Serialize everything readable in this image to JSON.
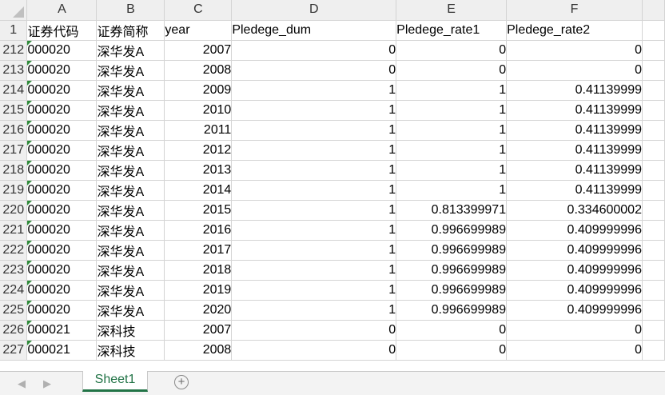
{
  "columns": [
    "A",
    "B",
    "C",
    "D",
    "E",
    "F"
  ],
  "header_row": {
    "row_num": "1",
    "cells": [
      "证券代码",
      "证券简称",
      "year",
      "Pledege_dum",
      "Pledege_rate1",
      "Pledege_rate2"
    ]
  },
  "rows": [
    {
      "num": "212",
      "code": "000020",
      "name": "深华发A",
      "year": "2007",
      "dum": "0",
      "rate1": "0",
      "rate2": "0"
    },
    {
      "num": "213",
      "code": "000020",
      "name": "深华发A",
      "year": "2008",
      "dum": "0",
      "rate1": "0",
      "rate2": "0"
    },
    {
      "num": "214",
      "code": "000020",
      "name": "深华发A",
      "year": "2009",
      "dum": "1",
      "rate1": "1",
      "rate2": "0.41139999"
    },
    {
      "num": "215",
      "code": "000020",
      "name": "深华发A",
      "year": "2010",
      "dum": "1",
      "rate1": "1",
      "rate2": "0.41139999"
    },
    {
      "num": "216",
      "code": "000020",
      "name": "深华发A",
      "year": "2011",
      "dum": "1",
      "rate1": "1",
      "rate2": "0.41139999"
    },
    {
      "num": "217",
      "code": "000020",
      "name": "深华发A",
      "year": "2012",
      "dum": "1",
      "rate1": "1",
      "rate2": "0.41139999"
    },
    {
      "num": "218",
      "code": "000020",
      "name": "深华发A",
      "year": "2013",
      "dum": "1",
      "rate1": "1",
      "rate2": "0.41139999"
    },
    {
      "num": "219",
      "code": "000020",
      "name": "深华发A",
      "year": "2014",
      "dum": "1",
      "rate1": "1",
      "rate2": "0.41139999"
    },
    {
      "num": "220",
      "code": "000020",
      "name": "深华发A",
      "year": "2015",
      "dum": "1",
      "rate1": "0.813399971",
      "rate2": "0.334600002"
    },
    {
      "num": "221",
      "code": "000020",
      "name": "深华发A",
      "year": "2016",
      "dum": "1",
      "rate1": "0.996699989",
      "rate2": "0.409999996"
    },
    {
      "num": "222",
      "code": "000020",
      "name": "深华发A",
      "year": "2017",
      "dum": "1",
      "rate1": "0.996699989",
      "rate2": "0.409999996"
    },
    {
      "num": "223",
      "code": "000020",
      "name": "深华发A",
      "year": "2018",
      "dum": "1",
      "rate1": "0.996699989",
      "rate2": "0.409999996"
    },
    {
      "num": "224",
      "code": "000020",
      "name": "深华发A",
      "year": "2019",
      "dum": "1",
      "rate1": "0.996699989",
      "rate2": "0.409999996"
    },
    {
      "num": "225",
      "code": "000020",
      "name": "深华发A",
      "year": "2020",
      "dum": "1",
      "rate1": "0.996699989",
      "rate2": "0.409999996"
    },
    {
      "num": "226",
      "code": "000021",
      "name": "深科技",
      "year": "2007",
      "dum": "0",
      "rate1": "0",
      "rate2": "0"
    },
    {
      "num": "227",
      "code": "000021",
      "name": "深科技",
      "year": "2008",
      "dum": "0",
      "rate1": "0",
      "rate2": "0"
    }
  ],
  "sheet_tabs": [
    "Sheet1"
  ],
  "icons": {
    "prev": "◀",
    "next": "▶",
    "add": "+"
  },
  "colors": {
    "accent": "#217346",
    "error_flag": "#2e8b3a",
    "header_bg": "#efefef"
  }
}
